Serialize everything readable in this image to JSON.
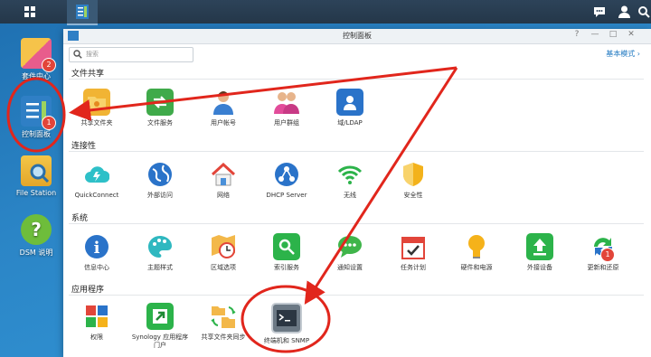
{
  "taskbar": {
    "menu_icon": "grid-icon",
    "active_app_icon": "control-panel-icon",
    "right_icons": [
      "chat-icon",
      "user-icon",
      "search-icon"
    ]
  },
  "desktop": {
    "icons": [
      {
        "label": "套件中心",
        "badge": "2"
      },
      {
        "label": "控制面板",
        "badge": "1"
      },
      {
        "label": "File Station",
        "badge": ""
      },
      {
        "label": "DSM 说明",
        "badge": ""
      }
    ]
  },
  "window": {
    "title": "控制面板",
    "controls": [
      "?",
      "—",
      "□",
      "✕"
    ],
    "search_placeholder": "搜索",
    "basic_mode": "基本模式",
    "sections": [
      {
        "title": "文件共享",
        "items": [
          "共享文件夹",
          "文件服务",
          "用户帐号",
          "用户群组",
          "域/LDAP"
        ]
      },
      {
        "title": "连接性",
        "items": [
          "QuickConnect",
          "外部访问",
          "网络",
          "DHCP Server",
          "无线",
          "安全性"
        ]
      },
      {
        "title": "系统",
        "items": [
          "信息中心",
          "主题样式",
          "区域选项",
          "索引服务",
          "通知设置",
          "任务计划",
          "硬件和电源",
          "外接设备",
          "更新和还原"
        ]
      },
      {
        "title": "应用程序",
        "items": [
          "权限",
          "Synology 应用程序门户",
          "共享文件夹同步",
          "终端机和 SNMP"
        ]
      }
    ],
    "update_badge": "1"
  },
  "colors": {
    "desktop_bg": "#2b85c6",
    "annotation_red": "#e1261c",
    "accent": "#1f78c1"
  }
}
